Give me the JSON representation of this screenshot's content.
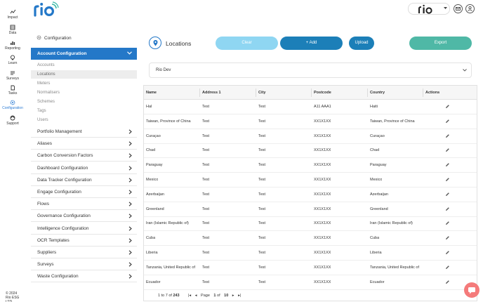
{
  "app": {
    "brand": "rio",
    "org_brand": "rio"
  },
  "rail": {
    "items": [
      {
        "label": "Impact",
        "icon": "impact-icon"
      },
      {
        "label": "Data",
        "icon": "data-icon"
      },
      {
        "label": "Reporting",
        "icon": "reporting-icon"
      },
      {
        "label": "Learn",
        "icon": "learn-icon"
      },
      {
        "label": "Surveys",
        "icon": "surveys-icon"
      },
      {
        "label": "Tasks",
        "icon": "tasks-icon"
      },
      {
        "label": "Configuration",
        "icon": "configuration-icon",
        "active": true
      },
      {
        "label": "Support",
        "icon": "support-icon"
      }
    ],
    "footer_line1": "© 2024",
    "footer_line2": "Rio ESG LTD"
  },
  "config": {
    "title": "Configuration",
    "account_section": {
      "label": "Account Configuration",
      "items": [
        "Accounts",
        "Locations",
        "Meters",
        "Normalisers",
        "Schemes",
        "Tags",
        "Users"
      ],
      "active_item": "Locations"
    },
    "sections": [
      "Portfolio Management",
      "Aliases",
      "Carbon Conversion Factors",
      "Dashboard Configuration",
      "Data Tracker Configuration",
      "Engage Configuration",
      "Flows",
      "Governance Configuration",
      "Intelligence Configuration",
      "OCR Templates",
      "Suppliers",
      "Surveys",
      "Waste Configuration"
    ]
  },
  "page": {
    "title": "Locations",
    "buttons": {
      "clear": "Clear",
      "add": "+ Add",
      "upload": "Upload",
      "export": "Export"
    },
    "site_select": "Rio Dev"
  },
  "table": {
    "columns": [
      "Name",
      "Address 1",
      "City",
      "Postcode",
      "Country",
      "Actions"
    ],
    "rows": [
      [
        "Hal",
        "Test",
        "Test",
        "A11 AAA1",
        "Haiti"
      ],
      [
        "Taiwan, Province of China",
        "Test",
        "Test",
        "XX1X1XX",
        "Taiwan, Province of China"
      ],
      [
        "Curaçao",
        "Test",
        "Test",
        "XX1X1XX",
        "Curaçao"
      ],
      [
        "Chad",
        "Test",
        "Test",
        "XX1X1XX",
        "Chad"
      ],
      [
        "Paraguay",
        "Test",
        "Test",
        "XX1X1XX",
        "Paraguay"
      ],
      [
        "Mexico",
        "Test",
        "Test",
        "XX1X1XX",
        "Mexico"
      ],
      [
        "Azerbaijan",
        "Test",
        "Test",
        "XX1X1XX",
        "Azerbaijan"
      ],
      [
        "Greenland",
        "Test",
        "Test",
        "XX1X1XX",
        "Greenland"
      ],
      [
        "Iran (Islamic Republic of)",
        "Test",
        "Test",
        "XX1X1XX",
        "Iran (Islamic Republic of)"
      ],
      [
        "Cuba",
        "Test",
        "Test",
        "XX1X1XX",
        "Cuba"
      ],
      [
        "Liberia",
        "Test",
        "Test",
        "XX1X1XX",
        "Liberia"
      ],
      [
        "Tanzania, United Republic of",
        "Test",
        "Test",
        "XX1X1XX",
        "Tanzania, United Republic of"
      ],
      [
        "Ecuador",
        "Test",
        "Test",
        "XX1X1XX",
        "Ecuador"
      ]
    ],
    "footer": {
      "range_from": "1",
      "range_to_word": "to",
      "range_to": "7",
      "range_of_word": "of",
      "total": "243",
      "page_word": "Page",
      "page": "1",
      "page_of_word": "of",
      "pages": "10"
    }
  },
  "colors": {
    "accent": "#2478c8",
    "clear_button": "#8fd6f2",
    "primary_button": "#1c7fb8",
    "export_button": "#4fb8a6",
    "chat": "#f47a7a"
  }
}
